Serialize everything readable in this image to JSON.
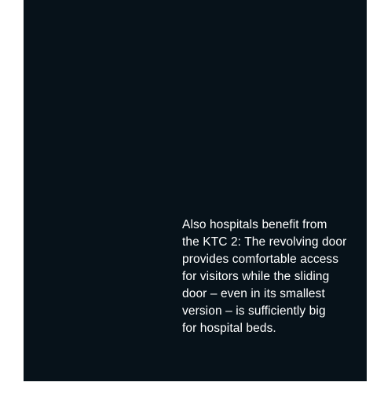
{
  "caption": {
    "lines": [
      "Also hospitals benefit from",
      "the KTC 2: The revolving door",
      "provides comfortable access",
      "for visitors while the sliding",
      "door – even in its smallest",
      "version – is sufficiently big",
      "for hospital beds."
    ]
  },
  "colors": {
    "panel_background": "#07121a",
    "page_background": "#ffffff",
    "caption_text": "#ffffff"
  }
}
